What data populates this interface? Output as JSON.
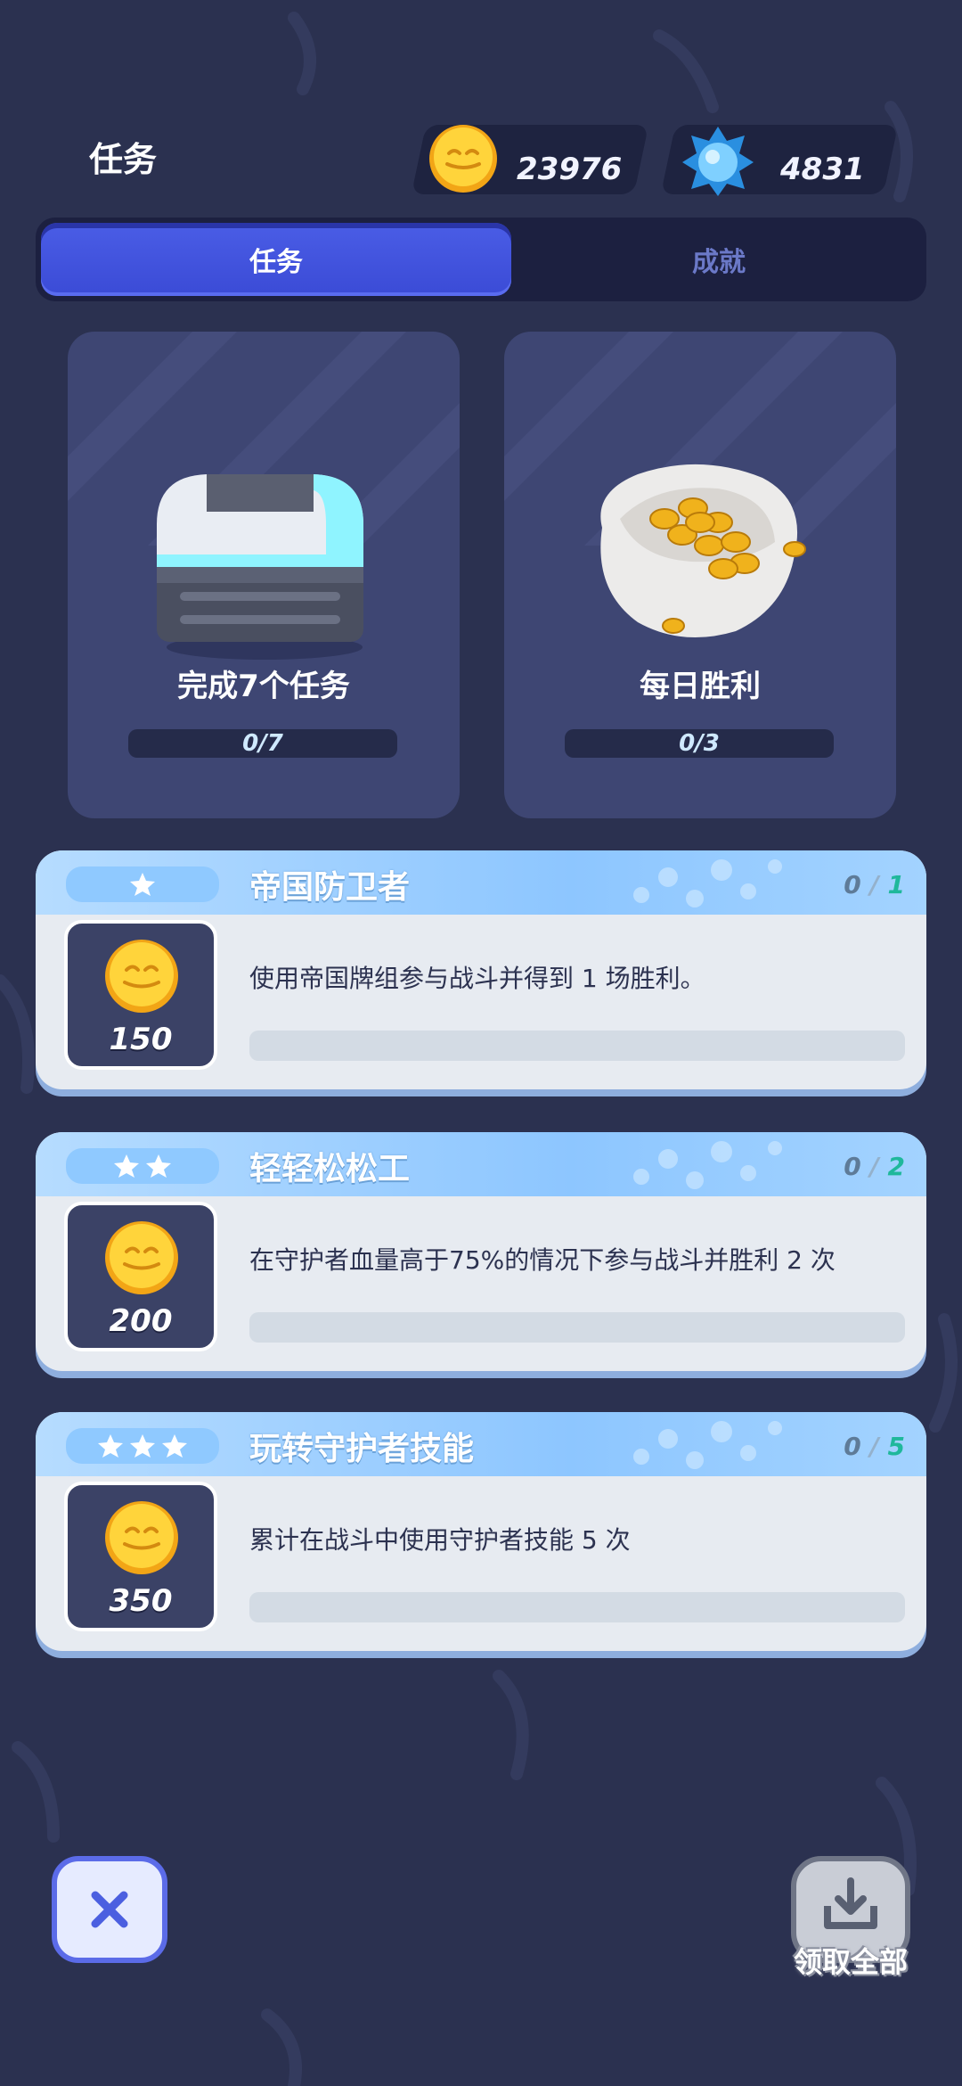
{
  "header": {
    "title": "任务",
    "coins": "23976",
    "gems": "4831"
  },
  "tabs": [
    {
      "label": "任务",
      "active": true
    },
    {
      "label": "成就",
      "active": false
    }
  ],
  "summary_cards": [
    {
      "label": "完成7个任务",
      "progress": "0/7",
      "icon": "chest-icon"
    },
    {
      "label": "每日胜利",
      "progress": "0/3",
      "icon": "coin-bag-icon"
    }
  ],
  "quests": [
    {
      "stars": 1,
      "title": "帝国防卫者",
      "count_current": "0",
      "count_max": "1",
      "reward": "150",
      "description": "使用帝国牌组参与战斗并得到 1 场胜利。",
      "progress": 0
    },
    {
      "stars": 2,
      "title": "轻轻松松工",
      "count_current": "0",
      "count_max": "2",
      "reward": "200",
      "description": "在守护者血量高于75%的情况下参与战斗并胜利 2 次",
      "progress": 0
    },
    {
      "stars": 3,
      "title": "玩转守护者技能",
      "count_current": "0",
      "count_max": "5",
      "reward": "350",
      "description": "累计在战斗中使用守护者技能 5 次",
      "progress": 0
    }
  ],
  "buttons": {
    "claim_all": "领取全部"
  },
  "colors": {
    "background": "#2b3150",
    "accent": "#4a5de6",
    "count_max": "#1fb89b"
  }
}
